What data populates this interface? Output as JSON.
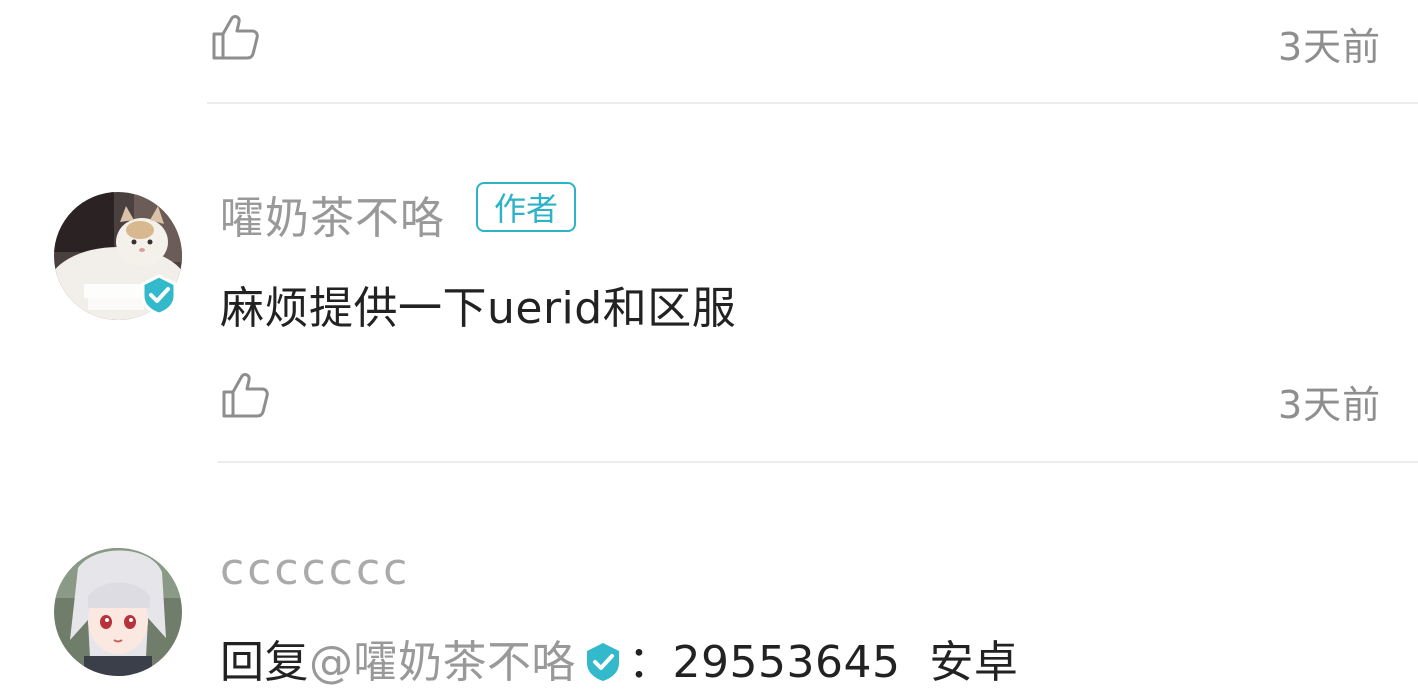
{
  "comments": [
    {
      "like_icon": "thumbs-up-icon",
      "time": "3天前"
    },
    {
      "username": "嚯奶茶不咯",
      "badge": "作者",
      "avatar_icon": "cat-avatar",
      "verified_icon": "verified-check-icon",
      "text": "麻烦提供一下uerid和区服",
      "like_icon": "thumbs-up-icon",
      "time": "3天前"
    },
    {
      "username": "ccccccc",
      "avatar_icon": "anime-character-avatar",
      "reply_prefix": "回复",
      "mention": "@嚯奶茶不咯",
      "reply_body": "：29553645  安卓"
    }
  ],
  "colors": {
    "accent": "#2db3c6",
    "muted_text": "#999999",
    "primary_text": "#222222",
    "divider": "#ececec"
  }
}
